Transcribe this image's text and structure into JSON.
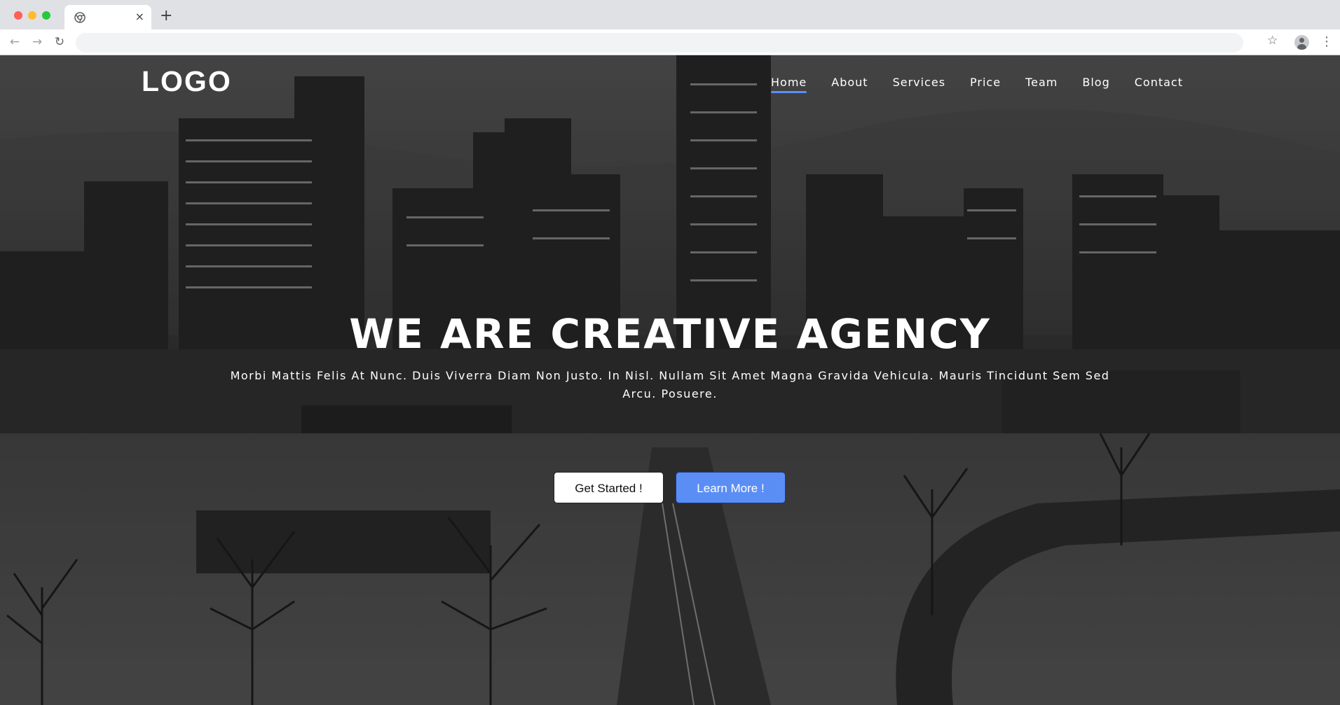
{
  "browser": {
    "tab_close_glyph": "×",
    "new_tab_glyph": "+",
    "back_glyph": "←",
    "forward_glyph": "→",
    "reload_glyph": "↻",
    "star_glyph": "☆",
    "menu_glyph": "⋮",
    "address": ""
  },
  "site": {
    "logo": "LOGO",
    "nav": [
      {
        "label": "Home",
        "active": true
      },
      {
        "label": "About"
      },
      {
        "label": "Services"
      },
      {
        "label": "Price"
      },
      {
        "label": "Team"
      },
      {
        "label": "Blog"
      },
      {
        "label": "Contact"
      }
    ],
    "hero": {
      "title": "WE ARE CREATIVE AGENCY",
      "subtitle": "Morbi Mattis Felis At Nunc. Duis Viverra Diam Non Justo. In Nisl. Nullam Sit Amet Magna Gravida Vehicula. Mauris Tincidunt Sem Sed Arcu. Posuere.",
      "primary_button": "Get Started !",
      "secondary_button": "Learn More !"
    }
  },
  "colors": {
    "accent": "#5b8ef5",
    "chrome_bg": "#dfe1e5"
  }
}
